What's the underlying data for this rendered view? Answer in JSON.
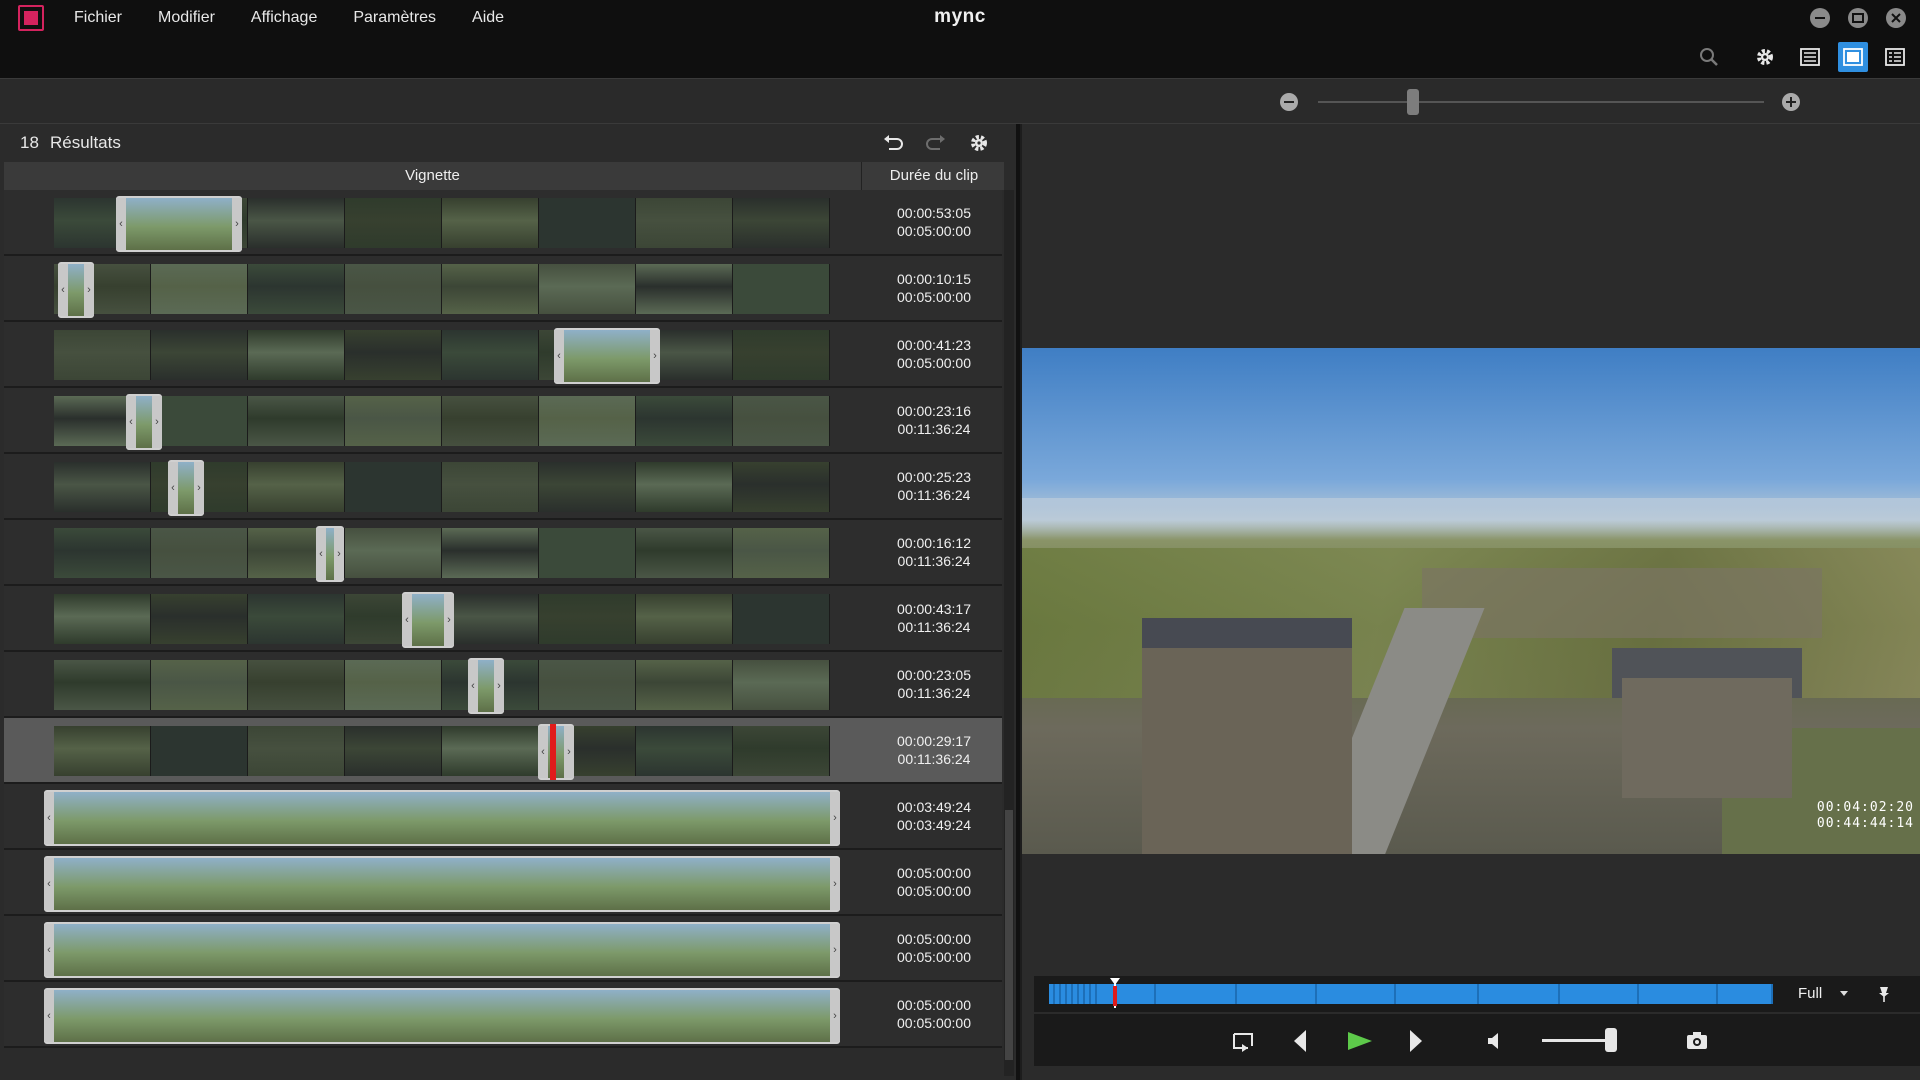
{
  "app": {
    "title": "mync",
    "accent_color": "#2f8fe0",
    "brand_color": "#d4235e"
  },
  "menu": {
    "items": [
      "Fichier",
      "Modifier",
      "Affichage",
      "Paramètres",
      "Aide"
    ]
  },
  "window_controls": [
    "minimize-icon",
    "restore-icon",
    "close-icon"
  ],
  "toolbar": {
    "icons": [
      "search-icon",
      "settings-gear-icon",
      "details-view-icon",
      "preview-view-icon",
      "list-view-icon"
    ],
    "active_view": "preview-view-icon"
  },
  "zoom": {
    "level": 0.2
  },
  "results": {
    "count": "18",
    "label": "Résultats",
    "header_icons": [
      "undo-icon",
      "redo-icon",
      "settings-gear-icon"
    ]
  },
  "columns": {
    "thumbnail": "Vignette",
    "duration": "Durée du clip"
  },
  "clips": [
    {
      "clip": "00:00:53:05",
      "total": "00:05:00:00",
      "selected": false
    },
    {
      "clip": "00:00:10:15",
      "total": "00:05:00:00",
      "selected": false
    },
    {
      "clip": "00:00:41:23",
      "total": "00:05:00:00",
      "selected": false
    },
    {
      "clip": "00:00:23:16",
      "total": "00:11:36:24",
      "selected": false
    },
    {
      "clip": "00:00:25:23",
      "total": "00:11:36:24",
      "selected": false
    },
    {
      "clip": "00:00:16:12",
      "total": "00:11:36:24",
      "selected": false
    },
    {
      "clip": "00:00:43:17",
      "total": "00:11:36:24",
      "selected": false
    },
    {
      "clip": "00:00:23:05",
      "total": "00:11:36:24",
      "selected": false
    },
    {
      "clip": "00:00:29:17",
      "total": "00:11:36:24",
      "selected": true
    },
    {
      "clip": "00:03:49:24",
      "total": "00:03:49:24",
      "selected": false
    },
    {
      "clip": "00:05:00:00",
      "total": "00:05:00:00",
      "selected": false
    },
    {
      "clip": "00:05:00:00",
      "total": "00:05:00:00",
      "selected": false
    },
    {
      "clip": "00:05:00:00",
      "total": "00:05:00:00",
      "selected": false
    }
  ],
  "preview": {
    "timecode_current": "00:04:02:20",
    "timecode_total": "00:44:44:14",
    "quality": "Full",
    "playhead_fraction": 0.09,
    "volume": 0.85
  },
  "playback_controls": [
    "loop-icon",
    "previous-frame-icon",
    "play-icon",
    "next-frame-icon",
    "volume-icon",
    "volume-slider",
    "snapshot-camera-icon"
  ]
}
